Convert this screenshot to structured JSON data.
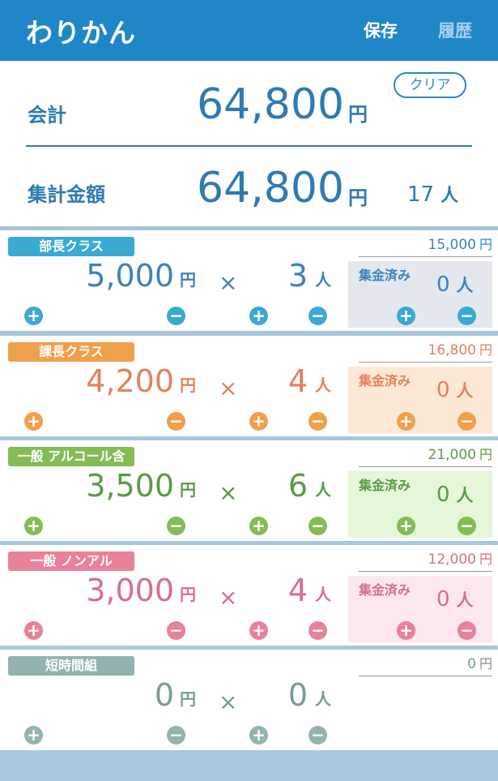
{
  "app": {
    "title": "わりかん",
    "save_label": "保存",
    "history_label": "履歴"
  },
  "summary": {
    "total_label": "会計",
    "total_value": "64,800",
    "yen": "円",
    "clear_label": "クリア",
    "collected_label": "集計金額",
    "collected_value": "64,800",
    "people_count": "17",
    "people_unit": "人"
  },
  "common": {
    "yen": "円",
    "person": "人",
    "times": "×",
    "plus": "+",
    "minus": "−",
    "collected_label": "集金済み"
  },
  "classes": [
    {
      "label": "部長クラス",
      "subtotal": "15,000",
      "price": "5,000",
      "count": "3",
      "collected": "0",
      "color": "#3aaad2",
      "text_color": "#3b82bd",
      "box_color": "#e3e8ee"
    },
    {
      "label": "課長クラス",
      "subtotal": "16,800",
      "price": "4,200",
      "count": "4",
      "collected": "0",
      "color": "#f0a04a",
      "text_color": "#e3825c",
      "box_color": "#fde8d5"
    },
    {
      "label": "一般 アルコール含",
      "subtotal": "21,000",
      "price": "3,500",
      "count": "6",
      "collected": "0",
      "color": "#85bc55",
      "text_color": "#5a9b48",
      "box_color": "#e6f6d8"
    },
    {
      "label": "一般 ノンアル",
      "subtotal": "12,000",
      "price": "3,000",
      "count": "4",
      "collected": "0",
      "color": "#e9819a",
      "text_color": "#d66f8b",
      "box_color": "#fde8ee"
    },
    {
      "label": "短時間組",
      "subtotal": "0",
      "price": "0",
      "count": "0",
      "collected": null,
      "color": "#92b3b0",
      "text_color": "#7a9a96",
      "box_color": null
    }
  ]
}
